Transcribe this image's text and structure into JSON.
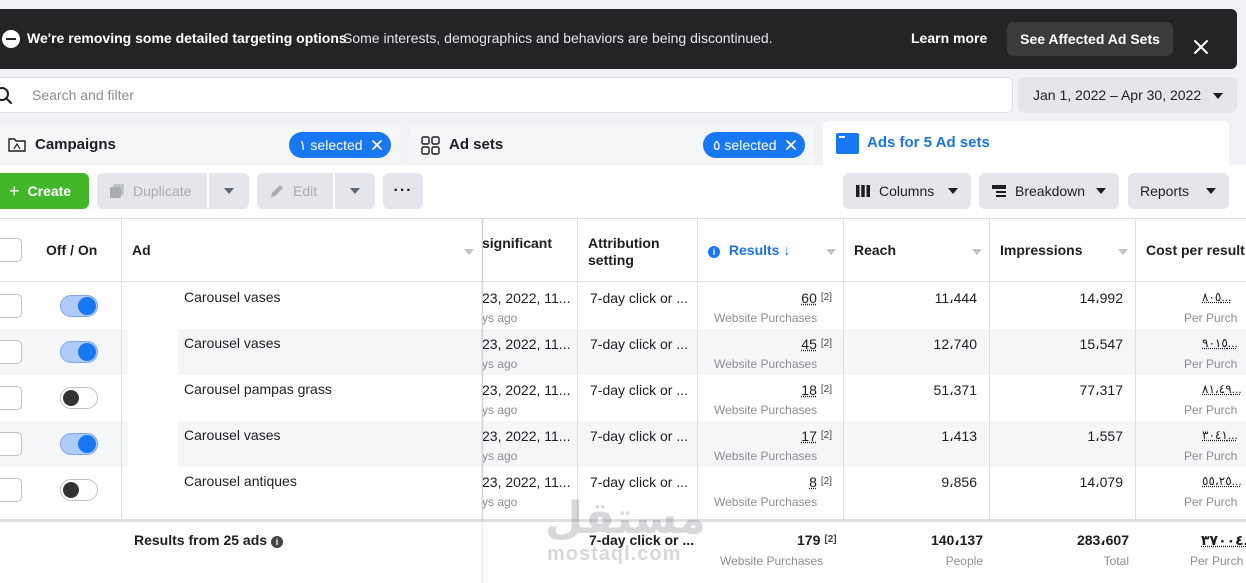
{
  "banner": {
    "title": "We're removing some detailed targeting options",
    "description": "Some interests, demographics and behaviors are being discontinued.",
    "learn_more": "Learn more",
    "affected_button": "See Affected Ad Sets"
  },
  "search": {
    "placeholder": "Search and filter"
  },
  "date_range": "Jan 1, 2022 – Apr 30, 2022",
  "tabs": {
    "campaigns": {
      "label": "Campaigns",
      "selected": "١ selected"
    },
    "adsets": {
      "label": "Ad sets",
      "selected": "٥ selected"
    },
    "ads": {
      "label": "Ads for 5 Ad sets"
    }
  },
  "toolbar": {
    "create": "Create",
    "duplicate": "Duplicate",
    "edit": "Edit",
    "more": "···",
    "columns": "Columns",
    "breakdown": "Breakdown",
    "reports": "Reports"
  },
  "table": {
    "headers": {
      "off_on": "Off / On",
      "ad": "Ad",
      "significant": "significant",
      "attribution": "Attribution setting",
      "results": "Results",
      "reach": "Reach",
      "impressions": "Impressions",
      "cost": "Cost per result"
    },
    "rows": [
      {
        "on": true,
        "name": "Carousel vases",
        "date": "23, 2022, 11...",
        "ago": "ys ago",
        "attribution": "7-day click or ...",
        "results": "60",
        "results_note": "[2]",
        "results_sub": "Website Purchases",
        "reach": "11،444",
        "impressions": "14،992",
        "cost": "٨٠٥...",
        "cost_sub": "Per Purch"
      },
      {
        "on": true,
        "name": "Carousel vases",
        "date": "23, 2022, 11...",
        "ago": "ys ago",
        "attribution": "7-day click or ...",
        "results": "45",
        "results_note": "[2]",
        "results_sub": "Website Purchases",
        "reach": "12،740",
        "impressions": "15،547",
        "cost": "٩٠١٥...",
        "cost_sub": "Per Purch"
      },
      {
        "on": false,
        "name": "Carousel pampas grass",
        "date": "23, 2022, 11...",
        "ago": "ys ago",
        "attribution": "7-day click or ...",
        "results": "18",
        "results_note": "[2]",
        "results_sub": "Website Purchases",
        "reach": "51،371",
        "impressions": "77،317",
        "cost": "٨١،٤٩...",
        "cost_sub": "Per Purch"
      },
      {
        "on": true,
        "name": "Carousel vases",
        "date": "23, 2022, 11...",
        "ago": "ys ago",
        "attribution": "7-day click or ...",
        "results": "17",
        "results_note": "[2]",
        "results_sub": "Website Purchases",
        "reach": "1،413",
        "impressions": "1،557",
        "cost": "٣٠٤١...",
        "cost_sub": "Per Purch"
      },
      {
        "on": false,
        "name": "Carousel antiques",
        "date": "23, 2022, 11...",
        "ago": "ys ago",
        "attribution": "7-day click or ...",
        "results": "8",
        "results_note": "[2]",
        "results_sub": "Website Purchases",
        "reach": "9،856",
        "impressions": "14،079",
        "cost": "٥٥،٢٥...",
        "cost_sub": "Per Purch"
      }
    ],
    "footer": {
      "label": "Results from 25 ads",
      "attribution": "7-day click or ...",
      "results": "179",
      "results_note": "[2]",
      "results_sub": "Website Purchases",
      "reach": "140،137",
      "reach_sub": "People",
      "impressions": "283،607",
      "impressions_sub": "Total",
      "cost": "٣٧٠٠٤...",
      "cost_sub": "Per Purch"
    }
  },
  "watermark": {
    "arabic": "مستقل",
    "latin": "mostaql.com"
  }
}
